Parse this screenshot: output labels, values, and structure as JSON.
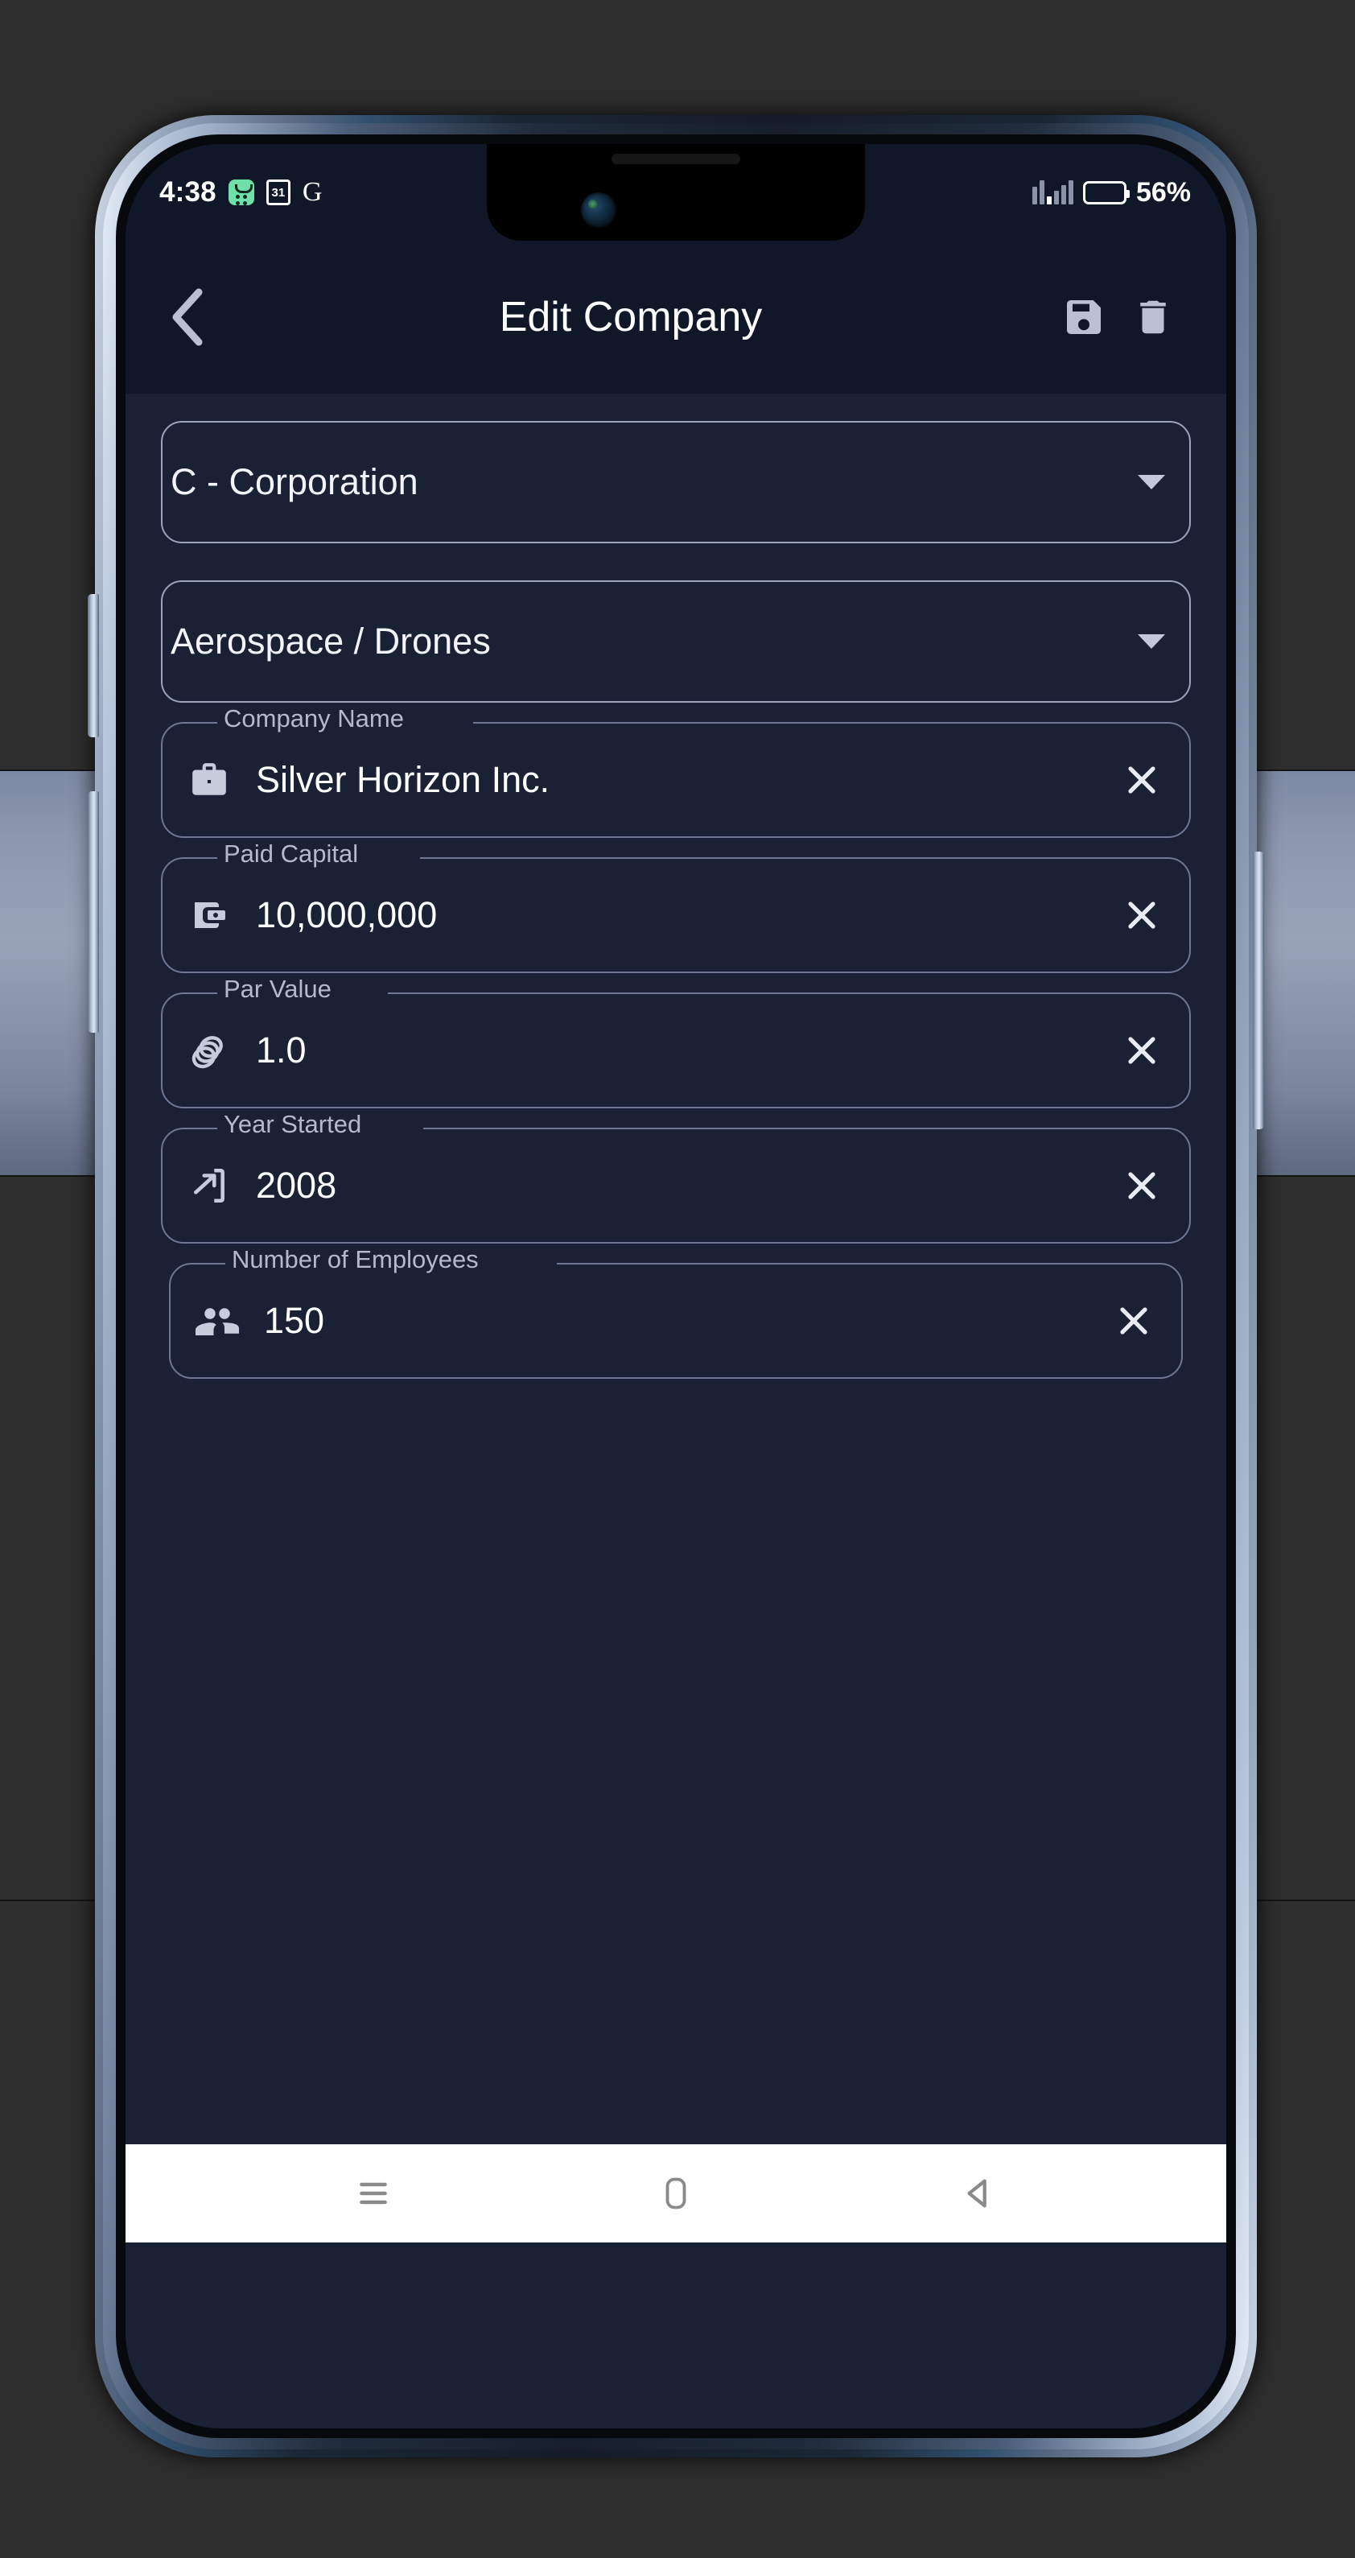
{
  "statusbar": {
    "time": "4:38",
    "icons": [
      "tasks-icon",
      "calendar-icon",
      "google-icon"
    ],
    "calendar_day": "31",
    "google_letter": "G",
    "battery_percent": "56%",
    "battery_level": 56,
    "signal_icon": "signal-bars-icon"
  },
  "appbar": {
    "back_icon": "chevron-left-icon",
    "title": "Edit Company",
    "save_icon": "save-icon",
    "delete_icon": "trash-icon"
  },
  "form": {
    "dropdowns": [
      {
        "name": "entity-type",
        "value": "C - Corporation",
        "caret_icon": "caret-down-icon"
      },
      {
        "name": "industry",
        "value": "Aerospace / Drones",
        "caret_icon": "caret-down-icon"
      }
    ],
    "fields": [
      {
        "name": "company-name",
        "label": "Company Name",
        "value": "Silver Horizon Inc.",
        "icon": "briefcase-icon",
        "clear_icon": "close-icon"
      },
      {
        "name": "paid-capital",
        "label": "Paid Capital",
        "value": "10,000,000",
        "icon": "wallet-icon",
        "clear_icon": "close-icon"
      },
      {
        "name": "par-value",
        "label": "Par Value",
        "value": "1.0",
        "icon": "coins-icon",
        "clear_icon": "close-icon"
      },
      {
        "name": "year-started",
        "label": "Year Started",
        "value": "2008",
        "icon": "launch-icon",
        "clear_icon": "close-icon"
      },
      {
        "name": "number-of-employees",
        "label": "Number of Employees",
        "value": "150",
        "icon": "people-icon",
        "clear_icon": "close-icon"
      }
    ]
  },
  "navbar": {
    "menu_icon": "menu-icon",
    "home_icon": "home-icon",
    "back_icon": "back-triangle-icon"
  },
  "colors": {
    "app_background": "#1b2135",
    "appbar_background": "#101728",
    "field_border": "#6d7794",
    "dropdown_border": "#9aa3bb",
    "label_text": "#b3bace",
    "value_text": "#ffffff",
    "navbar_background": "#ffffff",
    "status_accent_green": "#6fe0a8"
  }
}
